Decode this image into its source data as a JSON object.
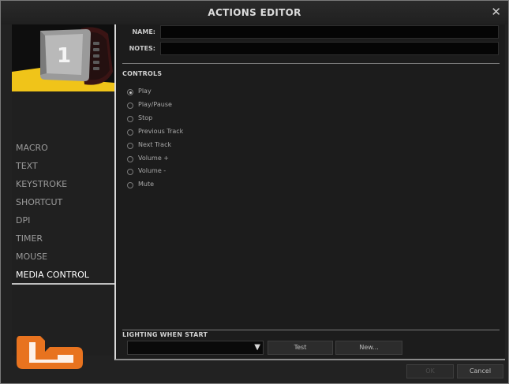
{
  "window": {
    "title": "ACTIONS EDITOR",
    "close_glyph": "✕"
  },
  "thumbnail": {
    "key_number": "1"
  },
  "nav": {
    "items": [
      {
        "label": "MACRO"
      },
      {
        "label": "TEXT"
      },
      {
        "label": "KEYSTROKE"
      },
      {
        "label": "SHORTCUT"
      },
      {
        "label": "DPI"
      },
      {
        "label": "TIMER"
      },
      {
        "label": "MOUSE"
      },
      {
        "label": "MEDIA CONTROL"
      }
    ],
    "active_index": 7
  },
  "form": {
    "name_label": "NAME:",
    "name_value": "",
    "notes_label": "NOTES:",
    "notes_value": ""
  },
  "controls": {
    "heading": "CONTROLS",
    "options": [
      {
        "label": "Play",
        "selected": true
      },
      {
        "label": "Play/Pause",
        "selected": false
      },
      {
        "label": "Stop",
        "selected": false
      },
      {
        "label": "Previous Track",
        "selected": false
      },
      {
        "label": "Next Track",
        "selected": false
      },
      {
        "label": "Volume +",
        "selected": false
      },
      {
        "label": "Volume -",
        "selected": false
      },
      {
        "label": "Mute",
        "selected": false
      }
    ]
  },
  "lighting": {
    "heading": "LIGHTING WHEN START",
    "selected_value": "",
    "test_label": "Test",
    "new_label": "New..."
  },
  "footer": {
    "ok_label": "OK",
    "cancel_label": "Cancel"
  },
  "colors": {
    "background": "#222222",
    "panel": "#1c1c1c",
    "accent_logo": "#e8731f"
  }
}
